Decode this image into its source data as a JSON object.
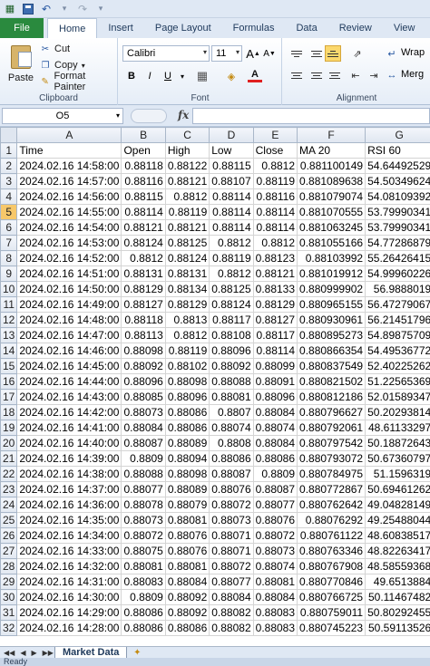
{
  "qat": {
    "icons": [
      "excel-icon",
      "save-icon",
      "undo-icon",
      "redo-icon",
      "customize-icon"
    ]
  },
  "tabs": {
    "file": "File",
    "items": [
      "Home",
      "Insert",
      "Page Layout",
      "Formulas",
      "Data",
      "Review",
      "View"
    ],
    "active": "Home"
  },
  "ribbon": {
    "clipboard": {
      "paste": "Paste",
      "cut": "Cut",
      "copy": "Copy",
      "format_painter": "Format Painter",
      "label": "Clipboard"
    },
    "font": {
      "name": "Calibri",
      "size": "11",
      "grow": "A",
      "shrink": "A",
      "bold": "B",
      "italic": "I",
      "underline": "U",
      "label": "Font"
    },
    "alignment": {
      "wrap": "Wrap",
      "merge": "Merg",
      "label": "Alignment"
    }
  },
  "formula_bar": {
    "name_box": "O5",
    "fx": "fx",
    "value": ""
  },
  "columns": [
    "A",
    "B",
    "C",
    "D",
    "E",
    "F",
    "G"
  ],
  "header_row": [
    "Time",
    "Open",
    "High",
    "Low",
    "Close",
    "MA 20",
    "RSI 60"
  ],
  "rows": [
    [
      "2024.02.16 14:58:00",
      "0.88118",
      "0.88122",
      "0.88115",
      "0.8812",
      "0.881100149",
      "54.64492529"
    ],
    [
      "2024.02.16 14:57:00",
      "0.88116",
      "0.88121",
      "0.88107",
      "0.88119",
      "0.881089638",
      "54.50349624"
    ],
    [
      "2024.02.16 14:56:00",
      "0.88115",
      "0.8812",
      "0.88114",
      "0.88116",
      "0.881079074",
      "54.08109392"
    ],
    [
      "2024.02.16 14:55:00",
      "0.88114",
      "0.88119",
      "0.88114",
      "0.88114",
      "0.881070555",
      "53.79990341"
    ],
    [
      "2024.02.16 14:54:00",
      "0.88121",
      "0.88121",
      "0.88114",
      "0.88114",
      "0.881063245",
      "53.79990341"
    ],
    [
      "2024.02.16 14:53:00",
      "0.88124",
      "0.88125",
      "0.8812",
      "0.8812",
      "0.881055166",
      "54.77286879"
    ],
    [
      "2024.02.16 14:52:00",
      "0.8812",
      "0.88124",
      "0.88119",
      "0.88123",
      "0.88103992",
      "55.26426415"
    ],
    [
      "2024.02.16 14:51:00",
      "0.88131",
      "0.88131",
      "0.8812",
      "0.88121",
      "0.881019912",
      "54.99960226"
    ],
    [
      "2024.02.16 14:50:00",
      "0.88129",
      "0.88134",
      "0.88125",
      "0.88133",
      "0.880999902",
      "56.9888019"
    ],
    [
      "2024.02.16 14:49:00",
      "0.88127",
      "0.88129",
      "0.88124",
      "0.88129",
      "0.880965155",
      "56.47279067"
    ],
    [
      "2024.02.16 14:48:00",
      "0.88118",
      "0.8813",
      "0.88117",
      "0.88127",
      "0.880930961",
      "56.21451796"
    ],
    [
      "2024.02.16 14:47:00",
      "0.88113",
      "0.8812",
      "0.88108",
      "0.88117",
      "0.880895273",
      "54.89875709"
    ],
    [
      "2024.02.16 14:46:00",
      "0.88098",
      "0.88119",
      "0.88096",
      "0.88114",
      "0.880866354",
      "54.49536772"
    ],
    [
      "2024.02.16 14:45:00",
      "0.88092",
      "0.88102",
      "0.88092",
      "0.88099",
      "0.880837549",
      "52.40225262"
    ],
    [
      "2024.02.16 14:44:00",
      "0.88096",
      "0.88098",
      "0.88088",
      "0.88091",
      "0.880821502",
      "51.22565369"
    ],
    [
      "2024.02.16 14:43:00",
      "0.88085",
      "0.88096",
      "0.88081",
      "0.88096",
      "0.880812186",
      "52.01589347"
    ],
    [
      "2024.02.16 14:42:00",
      "0.88073",
      "0.88086",
      "0.8807",
      "0.88084",
      "0.880796627",
      "50.20293814"
    ],
    [
      "2024.02.16 14:41:00",
      "0.88084",
      "0.88086",
      "0.88074",
      "0.88074",
      "0.880792061",
      "48.61133297"
    ],
    [
      "2024.02.16 14:40:00",
      "0.88087",
      "0.88089",
      "0.8808",
      "0.88084",
      "0.880797542",
      "50.18872643"
    ],
    [
      "2024.02.16 14:39:00",
      "0.8809",
      "0.88094",
      "0.88086",
      "0.88086",
      "0.880793072",
      "50.67360797"
    ],
    [
      "2024.02.16 14:38:00",
      "0.88088",
      "0.88098",
      "0.88087",
      "0.8809",
      "0.880784975",
      "51.1596319"
    ],
    [
      "2024.02.16 14:37:00",
      "0.88077",
      "0.88089",
      "0.88076",
      "0.88087",
      "0.880772867",
      "50.69461262"
    ],
    [
      "2024.02.16 14:36:00",
      "0.88078",
      "0.88079",
      "0.88072",
      "0.88077",
      "0.880762642",
      "49.04828149"
    ],
    [
      "2024.02.16 14:35:00",
      "0.88073",
      "0.88081",
      "0.88073",
      "0.88076",
      "0.88076292",
      "49.25488044"
    ],
    [
      "2024.02.16 14:34:00",
      "0.88072",
      "0.88076",
      "0.88071",
      "0.88072",
      "0.880761122",
      "48.60838517"
    ],
    [
      "2024.02.16 14:33:00",
      "0.88075",
      "0.88076",
      "0.88071",
      "0.88073",
      "0.880763346",
      "48.82263417"
    ],
    [
      "2024.02.16 14:32:00",
      "0.88081",
      "0.88081",
      "0.88072",
      "0.88074",
      "0.880767908",
      "48.58559368"
    ],
    [
      "2024.02.16 14:31:00",
      "0.88083",
      "0.88084",
      "0.88077",
      "0.88081",
      "0.880770846",
      "49.6513884"
    ],
    [
      "2024.02.16 14:30:00",
      "0.8809",
      "0.88092",
      "0.88084",
      "0.88084",
      "0.880766725",
      "50.11467482"
    ],
    [
      "2024.02.16 14:29:00",
      "0.88086",
      "0.88092",
      "0.88082",
      "0.88083",
      "0.880759011",
      "50.80292455"
    ],
    [
      "2024.02.16 14:28:00",
      "0.88086",
      "0.88086",
      "0.88082",
      "0.88083",
      "0.880745223",
      "50.59113526"
    ]
  ],
  "selected_row": 5,
  "sheets": {
    "active": "Market Data"
  },
  "status": {
    "text": "Ready"
  },
  "colors": {
    "file_tab": "#2a8a3e",
    "selected_header": "#f7c86a",
    "ribbon_bg": "#dfe8f4"
  }
}
